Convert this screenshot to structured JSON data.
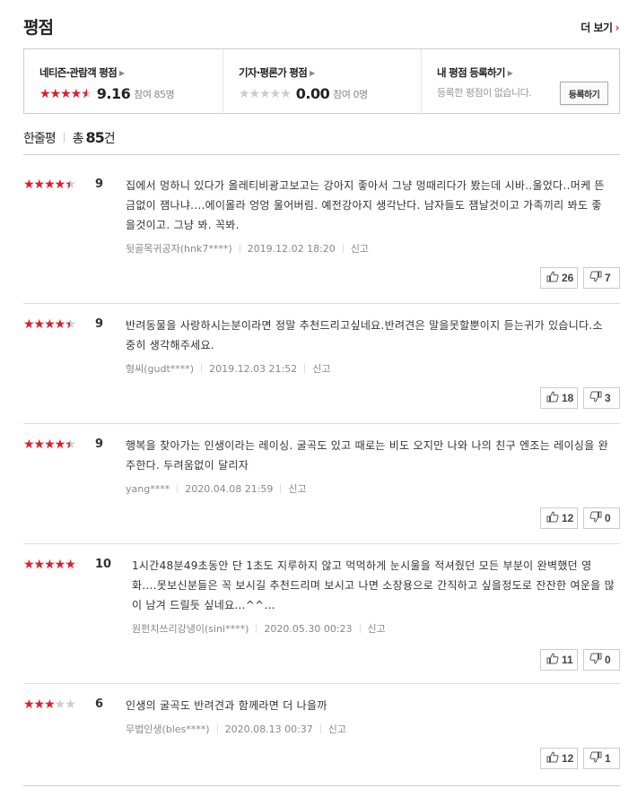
{
  "header": {
    "title": "평점",
    "more_label": "더 보기"
  },
  "summary": {
    "netizen": {
      "label": "네티즌·관람객 평점",
      "score": "9.16",
      "participants": "참여 85명",
      "rating": 0.916
    },
    "critic": {
      "label": "기자·평론가 평점",
      "score": "0.00",
      "participants": "참여 0명",
      "rating": 0
    },
    "mine": {
      "label": "내 평점 등록하기",
      "empty_text": "등록한 평점이 없습니다.",
      "register_button": "등록하기"
    }
  },
  "section": {
    "title": "한줄평",
    "total_prefix": "총",
    "total_count": "85",
    "total_suffix": "건"
  },
  "colors": {
    "accent": "#e21c2a",
    "star_empty": "#cccccc"
  },
  "reviews": [
    {
      "score": "9",
      "rating": 0.9,
      "text": "집에서 멍하니 있다가 올레티비광고보고는 강아지 좋아서 그냥 멍때리다가 봤는데 시바..울었다..머케 뜬금없이 잼나냐....에이몰라 엉엉 울어버림. 예전강아지 생각난다. 남자들도 잼날것이고 가족끼리 봐도 좋을것이고. 그냥 봐. 꼭봐.",
      "author": "뒷골목귀공자(hnk7****)",
      "date": "2019.12.02 18:20",
      "report": "신고",
      "up": "26",
      "down": "7"
    },
    {
      "score": "9",
      "rating": 0.9,
      "text": "반려동물을 사랑하시는분이라면 정말 추천드리고싶네요.반려견은 말을못할뿐이지 듣는귀가 있습니다.소중히 생각해주세요.",
      "author": "형씨(gudt****)",
      "date": "2019.12.03 21:52",
      "report": "신고",
      "up": "18",
      "down": "3"
    },
    {
      "score": "9",
      "rating": 0.9,
      "text": "행복을 찾아가는 인생이라는 레이싱. 굴곡도 있고 때로는 비도 오지만 나와 나의 친구 엔조는 레이싱을 완주한다. 두려움없이 달리자",
      "author": "yang****",
      "date": "2020.04.08 21:59",
      "report": "신고",
      "up": "12",
      "down": "0"
    },
    {
      "score": "10",
      "rating": 1.0,
      "text": "1시간48분49초동안 단 1초도 지루하지 않고 먹먹하게 눈시울을 적셔줬던 모든 부분이 완벽했던 영화....못보신분들은 꼭 보시길 추천드리며 보시고 나면 소장용으로 간직하고 싶을정도로 잔잔한 여운을 많이 남겨 드릴듯 싶네요...^^...",
      "author": "원펀치쓰리강냉이(sini****)",
      "date": "2020.05.30 00:23",
      "report": "신고",
      "up": "11",
      "down": "0"
    },
    {
      "score": "6",
      "rating": 0.6,
      "text": "인생의 굴곡도 반려견과 함께라면 더 나을까",
      "author": "무법인생(bles****)",
      "date": "2020.08.13 00:37",
      "report": "신고",
      "up": "12",
      "down": "1"
    }
  ]
}
